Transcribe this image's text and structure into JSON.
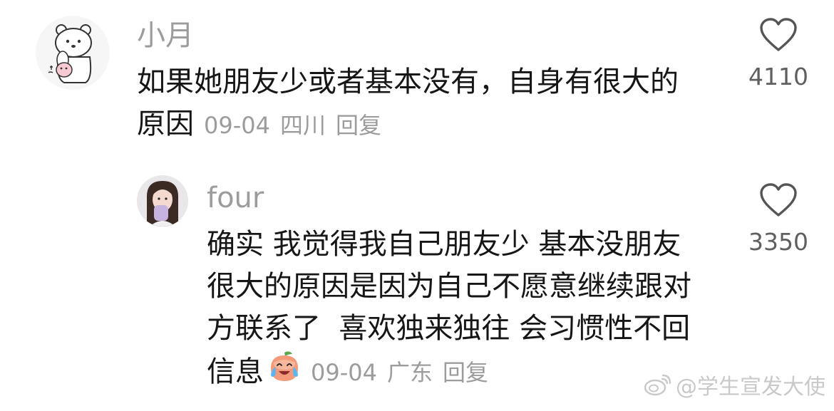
{
  "comments": [
    {
      "username": "小月",
      "text_lines": [
        "如果她朋友少或者基本没有，自身有很大的",
        "原因"
      ],
      "date": "09-04",
      "location": "四川",
      "reply_label": "回复",
      "like_count": "4110",
      "avatar_icon": "bear-with-bunny-avatar"
    },
    {
      "username": "four",
      "text_lines": [
        "确实 我觉得我自己朋友少 基本没朋友",
        "很大的原因是因为自己不愿意继续跟对",
        "方联系了  喜欢独来独往 会习惯性不回",
        "信息"
      ],
      "emoji": "crying-laughing-peach-emoji",
      "date": "09-04",
      "location": "广东",
      "reply_label": "回复",
      "like_count": "3350",
      "avatar_icon": "girl-portrait-avatar"
    }
  ],
  "watermark": {
    "prefix": "@",
    "text": "学生宣发大使",
    "icon": "weibo-logo-icon"
  },
  "colors": {
    "text": "#161616",
    "meta": "#9c9c9c",
    "like_icon": "#555555"
  }
}
